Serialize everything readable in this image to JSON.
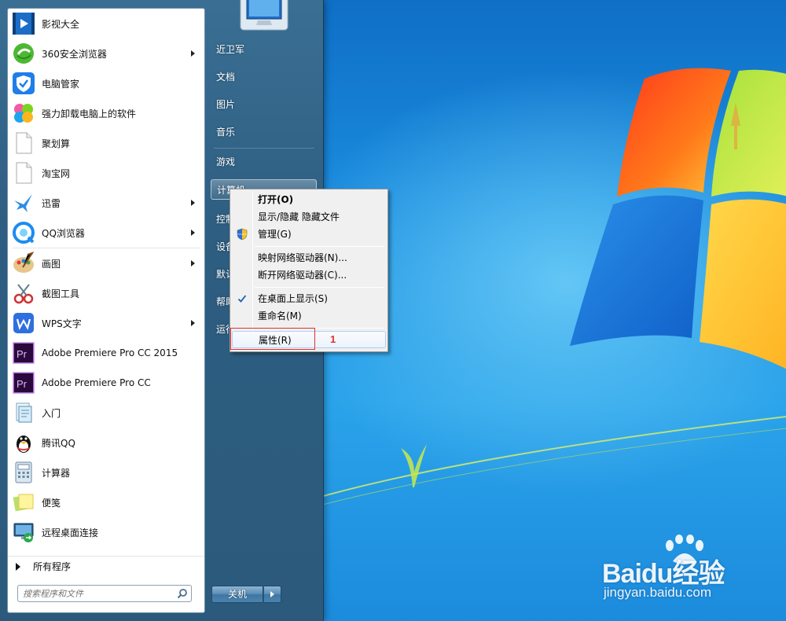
{
  "start_menu": {
    "programs": [
      {
        "label": "影视大全",
        "icon": "video-player-icon",
        "submenu": false
      },
      {
        "label": "360安全浏览器",
        "icon": "360-browser-icon",
        "submenu": true
      },
      {
        "label": "电脑管家",
        "icon": "pc-manager-shield-icon",
        "submenu": false
      },
      {
        "label": "强力卸载电脑上的软件",
        "icon": "uninstall-clover-icon",
        "submenu": false
      },
      {
        "label": "聚划算",
        "icon": "blank-document-icon",
        "submenu": false
      },
      {
        "label": "淘宝网",
        "icon": "blank-document-icon",
        "submenu": false
      },
      {
        "label": "迅雷",
        "icon": "thunder-bird-icon",
        "submenu": true
      },
      {
        "label": "QQ浏览器",
        "icon": "qq-browser-icon",
        "submenu": true
      },
      {
        "label": "画图",
        "icon": "paint-palette-icon",
        "submenu": true
      },
      {
        "label": "截图工具",
        "icon": "snipping-tool-icon",
        "submenu": false
      },
      {
        "label": "WPS文字",
        "icon": "wps-writer-icon",
        "submenu": true
      },
      {
        "label": "Adobe Premiere Pro CC 2015",
        "icon": "premiere-pro-icon",
        "submenu": false
      },
      {
        "label": "Adobe Premiere Pro CC",
        "icon": "premiere-pro-icon",
        "submenu": false
      },
      {
        "label": "入门",
        "icon": "getting-started-icon",
        "submenu": false
      },
      {
        "label": "腾讯QQ",
        "icon": "qq-penguin-icon",
        "submenu": false
      },
      {
        "label": "计算器",
        "icon": "calculator-icon",
        "submenu": false
      },
      {
        "label": "便笺",
        "icon": "sticky-notes-icon",
        "submenu": false
      },
      {
        "label": "远程桌面连接",
        "icon": "remote-desktop-icon",
        "submenu": false
      }
    ],
    "all_programs": "所有程序",
    "search_placeholder": "搜索程序和文件",
    "right_links": {
      "user": "近卫军",
      "documents": "文档",
      "pictures": "图片",
      "music": "音乐",
      "games": "游戏",
      "computer": "计算机",
      "control_panel": "控制",
      "devices": "设备",
      "defaults": "默认",
      "help": "帮助",
      "run": "运行"
    },
    "shutdown": "关机"
  },
  "context_menu": {
    "open": "打开(O)",
    "show_hide": "显示/隐藏 隐藏文件",
    "manage": "管理(G)",
    "map_drive": "映射网络驱动器(N)...",
    "disconnect_drive": "断开网络驱动器(C)...",
    "show_on_desktop": "在桌面上显示(S)",
    "rename": "重命名(M)",
    "properties": "属性(R)"
  },
  "annotation": {
    "number": "1",
    "color": "#e0312f"
  },
  "watermark": {
    "brand": "Baidu经验",
    "url": "jingyan.baidu.com"
  }
}
